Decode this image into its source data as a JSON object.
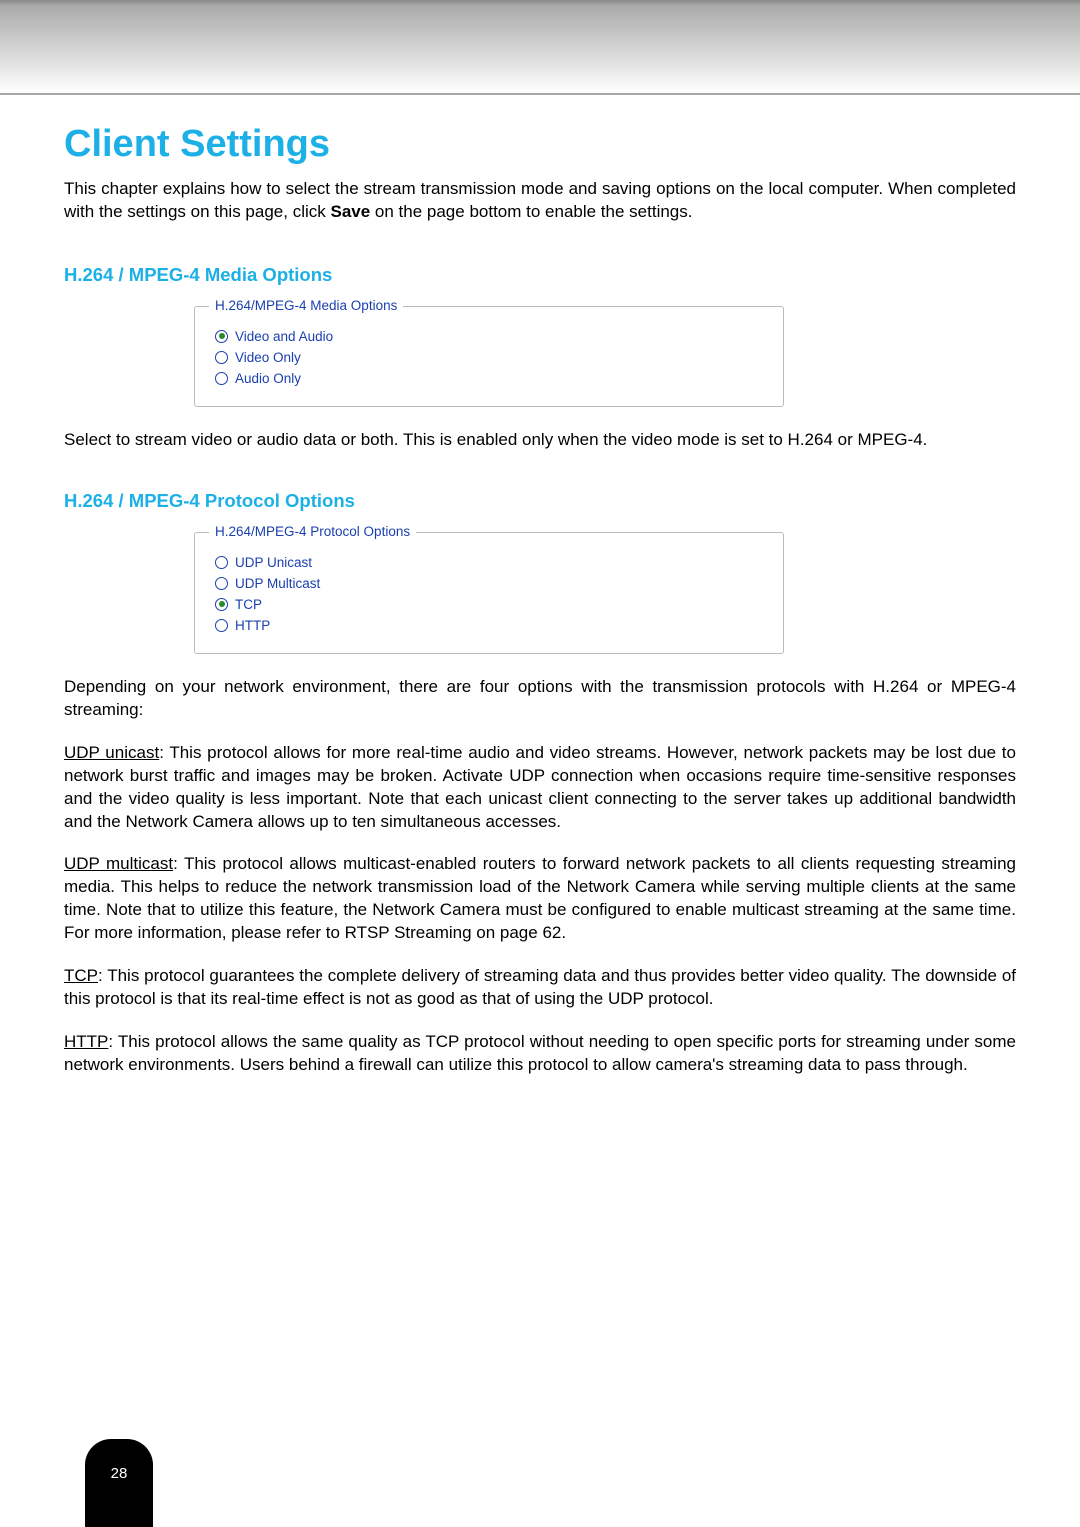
{
  "heading": "Client Settings",
  "intro_before_bold": "This chapter explains how to select the stream transmission mode and saving options on the local computer. When completed with the settings on this page, click ",
  "intro_bold": "Save",
  "intro_after_bold": " on the page bottom to enable the settings.",
  "section_media": {
    "title": "H.264 / MPEG-4 Media Options",
    "legend": "H.264/MPEG-4 Media Options",
    "options": [
      {
        "label": "Video and Audio",
        "selected": true
      },
      {
        "label": "Video Only",
        "selected": false
      },
      {
        "label": "Audio Only",
        "selected": false
      }
    ],
    "desc": "Select to stream video or audio data or both. This is enabled only when the video mode is set to H.264 or MPEG-4."
  },
  "section_protocol": {
    "title": "H.264 / MPEG-4 Protocol Options",
    "legend": "H.264/MPEG-4 Protocol Options",
    "options": [
      {
        "label": "UDP Unicast",
        "selected": false
      },
      {
        "label": "UDP Multicast",
        "selected": false
      },
      {
        "label": "TCP",
        "selected": true
      },
      {
        "label": "HTTP",
        "selected": false
      }
    ],
    "desc": "Depending on your network environment, there are four options with the transmission protocols with H.264 or MPEG-4 streaming:",
    "udp_unicast_label": "UDP unicast",
    "udp_unicast_body": ": This protocol allows for more real-time audio and video streams. However, network packets may be lost due to network burst traffic and images may be broken. Activate UDP connection when occasions require time-sensitive responses and the video quality is less important. Note that each unicast client connecting to the server takes up additional bandwidth and the Network Camera allows up to ten simultaneous accesses.",
    "udp_multicast_label": "UDP multicast",
    "udp_multicast_body": ": This protocol allows multicast-enabled routers to forward network packets to all clients requesting streaming media. This helps to reduce the network transmission load of the Network Camera while serving multiple clients at the same time. Note that to utilize this feature, the Network Camera must be configured to enable multicast streaming at the same time. For more information, please refer to RTSP Streaming on page 62.",
    "tcp_label": "TCP",
    "tcp_body": ": This protocol guarantees the complete delivery of streaming data and thus provides better video quality. The downside of this protocol is that its real-time effect is not as good as that of using the UDP protocol.",
    "http_label": "HTTP",
    "http_body": ": This protocol allows the same quality as TCP protocol without needing to open specific ports for streaming under some network environments. Users behind a firewall can utilize this protocol to allow camera's streaming data to pass through."
  },
  "page_number": "28"
}
